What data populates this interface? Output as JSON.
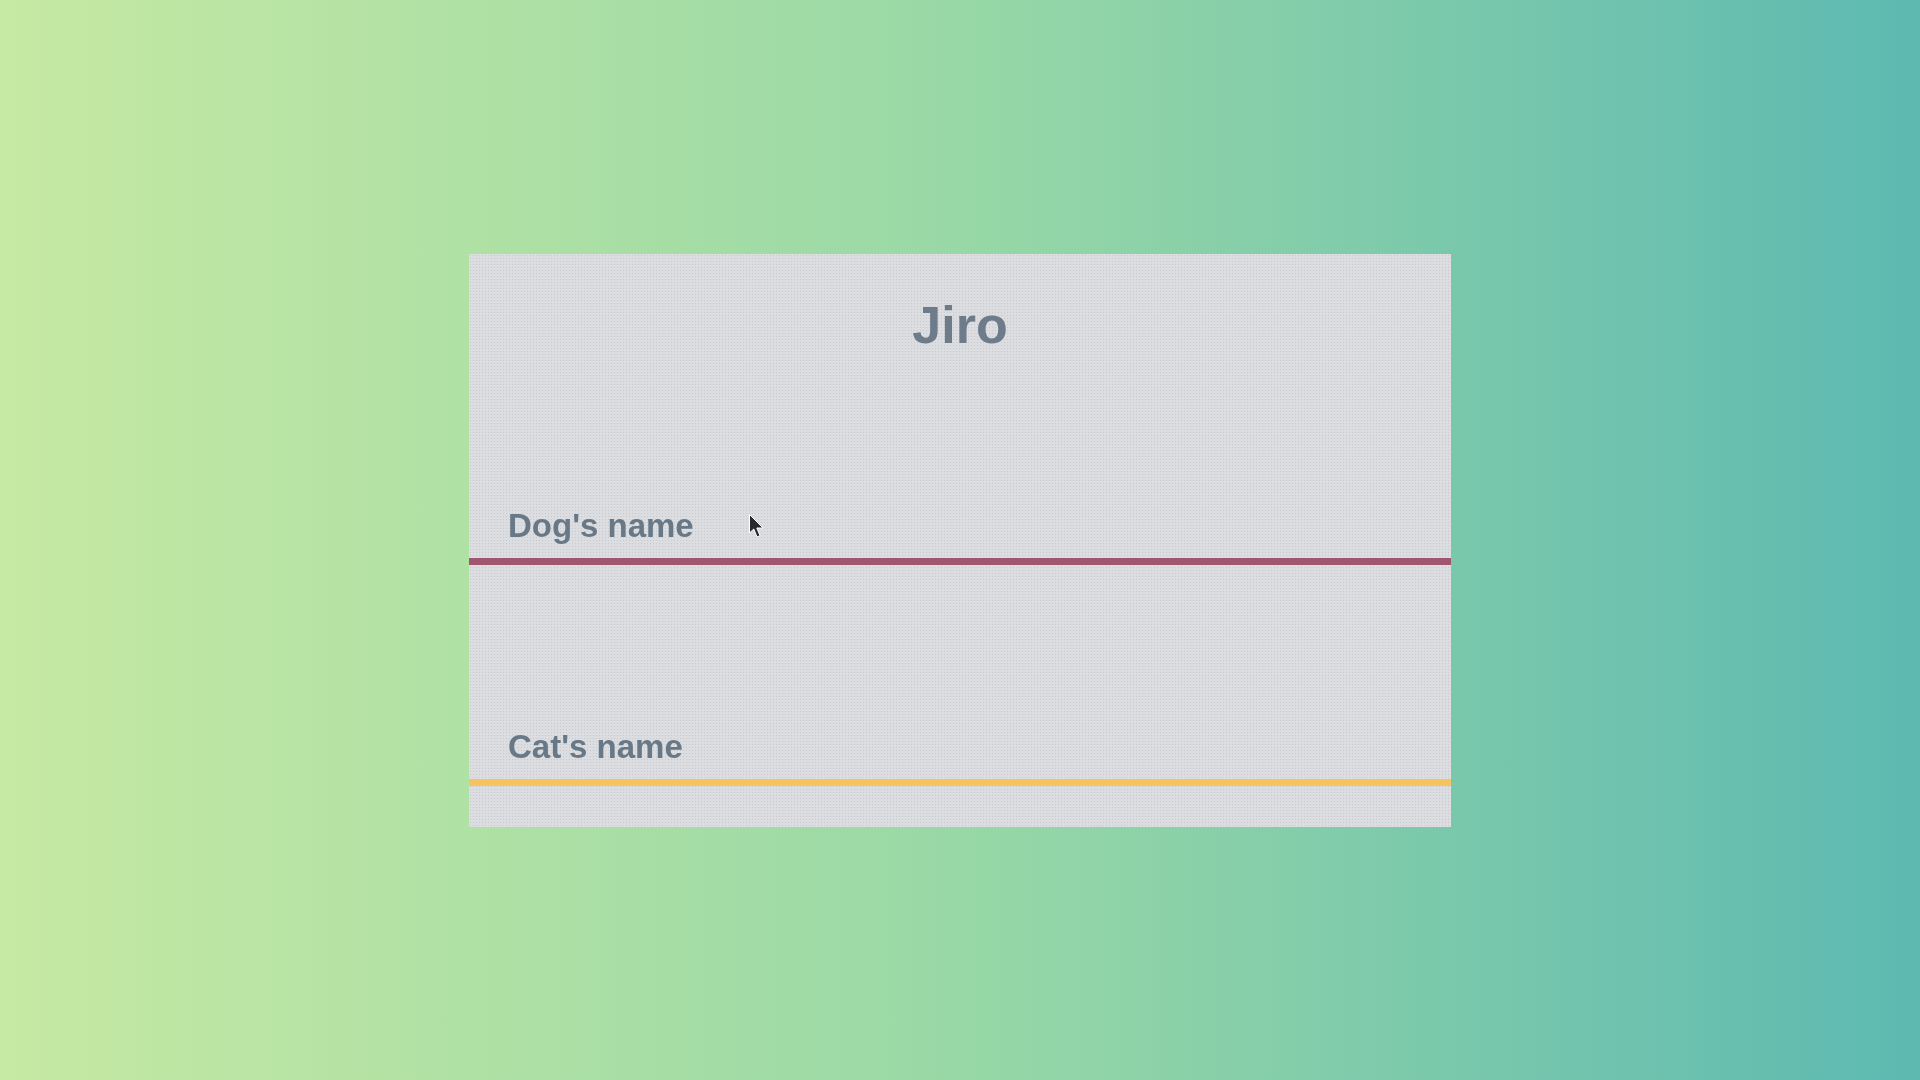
{
  "card": {
    "title": "Jiro",
    "fields": [
      {
        "placeholder": "Dog's name",
        "color": "#a0566f"
      },
      {
        "placeholder": "Cat's name",
        "color": "#f6c35f"
      }
    ]
  }
}
